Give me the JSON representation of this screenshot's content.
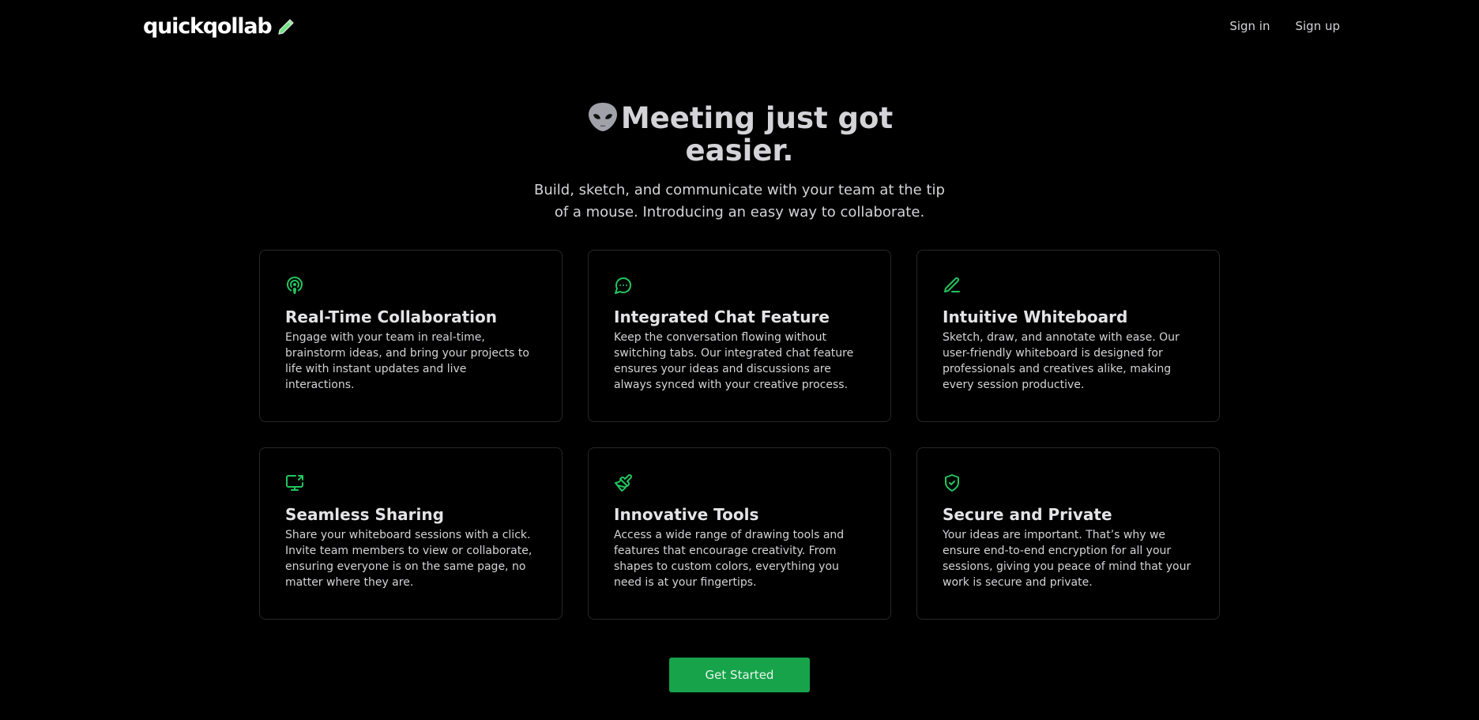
{
  "nav": {
    "logo_text": "quickqollab",
    "logo_icon": "pencil-icon",
    "sign_in": "Sign in",
    "sign_up": "Sign up"
  },
  "hero": {
    "emoji": "alien-emoji",
    "title": "Meeting just got easier.",
    "subtitle": "Build, sketch, and communicate with your team at the tip of a mouse. Introducing an easy way to collaborate."
  },
  "features": [
    {
      "icon": "podcast-icon",
      "title": "Real-Time Collaboration",
      "description": "Engage with your team in real-time, brainstorm ideas, and bring your projects to life with instant updates and live interactions."
    },
    {
      "icon": "chat-bubble-icon",
      "title": "Integrated Chat Feature",
      "description": "Keep the conversation flowing without switching tabs. Our integrated chat feature ensures your ideas and discussions are always synced with your creative process."
    },
    {
      "icon": "pen-line-icon",
      "title": "Intuitive Whiteboard",
      "description": "Sketch, draw, and annotate with ease. Our user-friendly whiteboard is designed for professionals and creatives alike, making every session productive."
    },
    {
      "icon": "screen-share-icon",
      "title": "Seamless Sharing",
      "description": "Share your whiteboard sessions with a click. Invite team members to view or collaborate, ensuring everyone is on the same page, no matter where they are."
    },
    {
      "icon": "paintbrush-icon",
      "title": "Innovative Tools",
      "description": "Access a wide range of drawing tools and features that encourage creativity. From shapes to custom colors, everything you need is at your fingertips."
    },
    {
      "icon": "shield-check-icon",
      "title": "Secure and Private",
      "description": "Your ideas are important. That’s why we ensure end-to-end encryption for all your sessions, giving you peace of mind that your work is secure and private."
    }
  ],
  "cta": {
    "label": "Get Started"
  },
  "colors": {
    "accent": "#22c55e",
    "button": "#16a34a",
    "background": "#000000",
    "card_border": "#27272a"
  }
}
